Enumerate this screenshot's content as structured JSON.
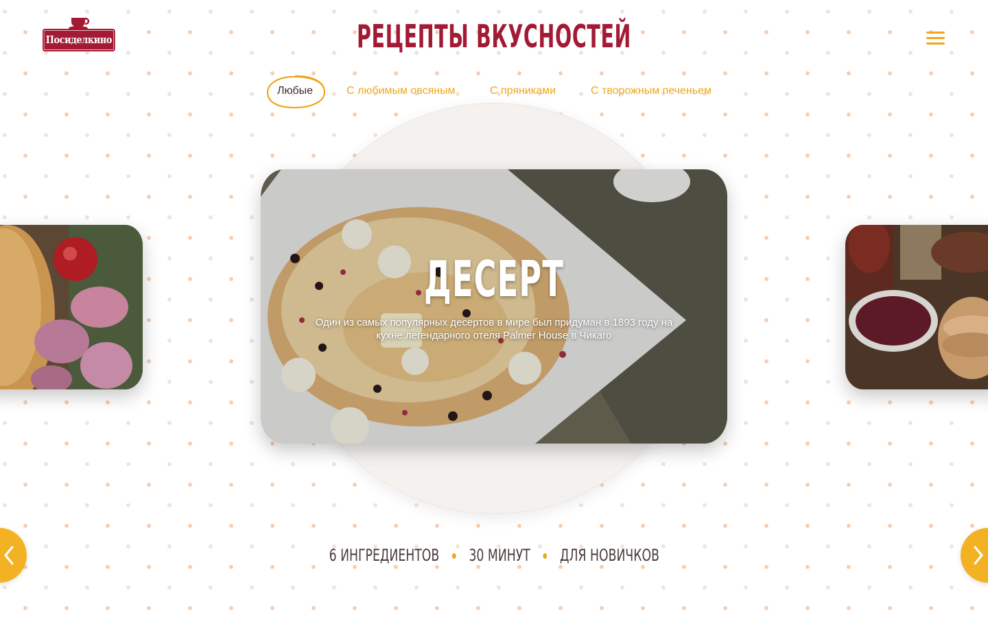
{
  "header": {
    "logo_text": "Посиделкино",
    "site_title": "РЕЦЕПТЫ ВКУСНОСТЕЙ",
    "menu_icon": "hamburger-menu-icon"
  },
  "tabs": [
    {
      "label": "Любые",
      "active": true
    },
    {
      "label": "С любимым овсяным",
      "active": false
    },
    {
      "label": "С пряниками",
      "active": false
    },
    {
      "label": "С творожным печеньем",
      "active": false
    }
  ],
  "carousel": {
    "current": {
      "title": "ДЕСЕРТ",
      "description": "Один из самых популярных десертов в мире был придуман в 1893 году на кухне легендарного отеля Palmer House в Чикаго"
    },
    "meta": {
      "ingredients": "6 ИНГРЕДИЕНТОВ",
      "time": "30 МИНУТ",
      "level": "ДЛЯ НОВИЧКОВ"
    },
    "prev_icon": "chevron-left-icon",
    "next_icon": "chevron-right-icon"
  },
  "colors": {
    "brand_red": "#a31a34",
    "accent_orange": "#f0a61b",
    "text_dark": "#3d2e2e"
  }
}
